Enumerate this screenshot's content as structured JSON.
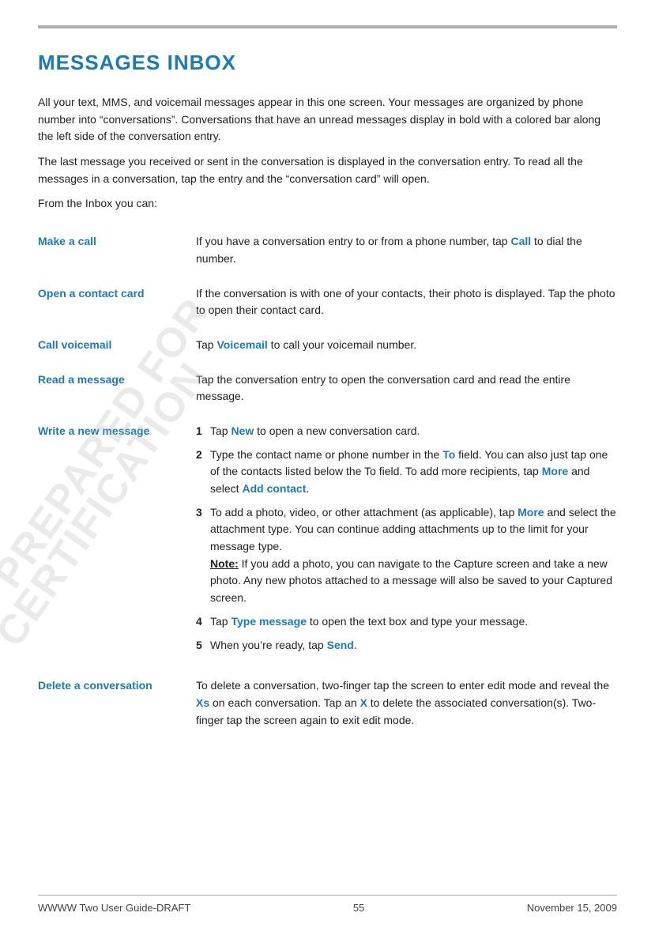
{
  "page": {
    "top_border": true,
    "title": "MESSAGES INBOX",
    "intro1": "All your text, MMS, and voicemail messages appear in this one screen. Your messages are organized by phone number into “conversations”. Conversations that have an unread messages display in bold with a colored bar along the left side of the conversation entry.",
    "intro2": "The last message you received or sent in the conversation is displayed in the conversation entry. To read all the messages in a conversation, tap the entry and the “conversation card” will open.",
    "from_inbox": "From the Inbox you can:",
    "features": [
      {
        "label": "Make a call",
        "description": "If you have a conversation entry to or from a phone number, tap {Call} to dial the number.",
        "desc_parts": [
          {
            "text": "If you have a conversation entry to or from a phone number, tap ",
            "highlight": false
          },
          {
            "text": "Call",
            "highlight": true
          },
          {
            "text": " to dial the number.",
            "highlight": false
          }
        ]
      },
      {
        "label": "Open a contact card",
        "description": "If the conversation is with one of your contacts, their photo is displayed. Tap the photo to open their contact card.",
        "desc_parts": [
          {
            "text": "If the conversation is with one of your contacts, their photo is displayed. Tap the photo to open their contact card.",
            "highlight": false
          }
        ]
      },
      {
        "label": "Call voicemail",
        "description": "Tap {Voicemail} to call your voicemail number.",
        "desc_parts": [
          {
            "text": "Tap ",
            "highlight": false
          },
          {
            "text": "Voicemail",
            "highlight": true
          },
          {
            "text": " to call your voicemail number.",
            "highlight": false
          }
        ]
      },
      {
        "label": "Read a message",
        "description": "Tap the conversation entry to open the conversation card and read the entire message.",
        "desc_parts": [
          {
            "text": "Tap the conversation entry to open the conversation card and read the entire message.",
            "highlight": false
          }
        ]
      },
      {
        "label": "Write a new message",
        "type": "list",
        "items": [
          {
            "num": "1",
            "parts": [
              {
                "text": "Tap ",
                "highlight": false
              },
              {
                "text": "New",
                "highlight": true
              },
              {
                "text": " to open a new conversation card.",
                "highlight": false
              }
            ]
          },
          {
            "num": "2",
            "parts": [
              {
                "text": "Type the contact name or phone number in the ",
                "highlight": false
              },
              {
                "text": "To",
                "highlight": true
              },
              {
                "text": " field. You can also just tap one of the contacts listed below the To field. To add more recipients, tap ",
                "highlight": false
              },
              {
                "text": "More",
                "highlight": true
              },
              {
                "text": " and select ",
                "highlight": false
              },
              {
                "text": "Add contact",
                "highlight": true
              },
              {
                "text": ".",
                "highlight": false
              }
            ]
          },
          {
            "num": "3",
            "parts": [
              {
                "text": "To add a photo, video, or other attachment (as applicable), tap ",
                "highlight": false
              },
              {
                "text": "More",
                "highlight": true
              },
              {
                "text": " and select the attachment type. You can continue adding attachments up to the limit for your message type.",
                "highlight": false
              },
              {
                "text": "\nNote:",
                "note": true
              },
              {
                "text": " If you add a photo, you can navigate to the Capture screen and take a new photo. Any new photos attached to a message will also be saved to your Captured screen.",
                "highlight": false
              }
            ]
          },
          {
            "num": "4",
            "parts": [
              {
                "text": "Tap ",
                "highlight": false
              },
              {
                "text": "Type message",
                "highlight": true
              },
              {
                "text": " to open the text box and type your message.",
                "highlight": false
              }
            ]
          },
          {
            "num": "5",
            "parts": [
              {
                "text": "When you’re ready, tap ",
                "highlight": false
              },
              {
                "text": "Send",
                "highlight": true
              },
              {
                "text": ".",
                "highlight": false
              }
            ]
          }
        ]
      },
      {
        "label": "Delete a conversation",
        "description": "",
        "desc_parts": [
          {
            "text": "To delete a conversation, two-finger tap the screen to enter edit mode and reveal the ",
            "highlight": false
          },
          {
            "text": "Xs",
            "highlight": true
          },
          {
            "text": " on each conversation. Tap an ",
            "highlight": false
          },
          {
            "text": "X",
            "highlight": true
          },
          {
            "text": " to delete the associated conversation(s). Two-finger tap the screen again to exit edit mode.",
            "highlight": false
          }
        ]
      }
    ],
    "footer": {
      "left": "WWWW Two User Guide-DRAFT",
      "center": "55",
      "right": "November 15, 2009"
    },
    "watermark": "PREPARED FOR CERTIFICATION"
  }
}
